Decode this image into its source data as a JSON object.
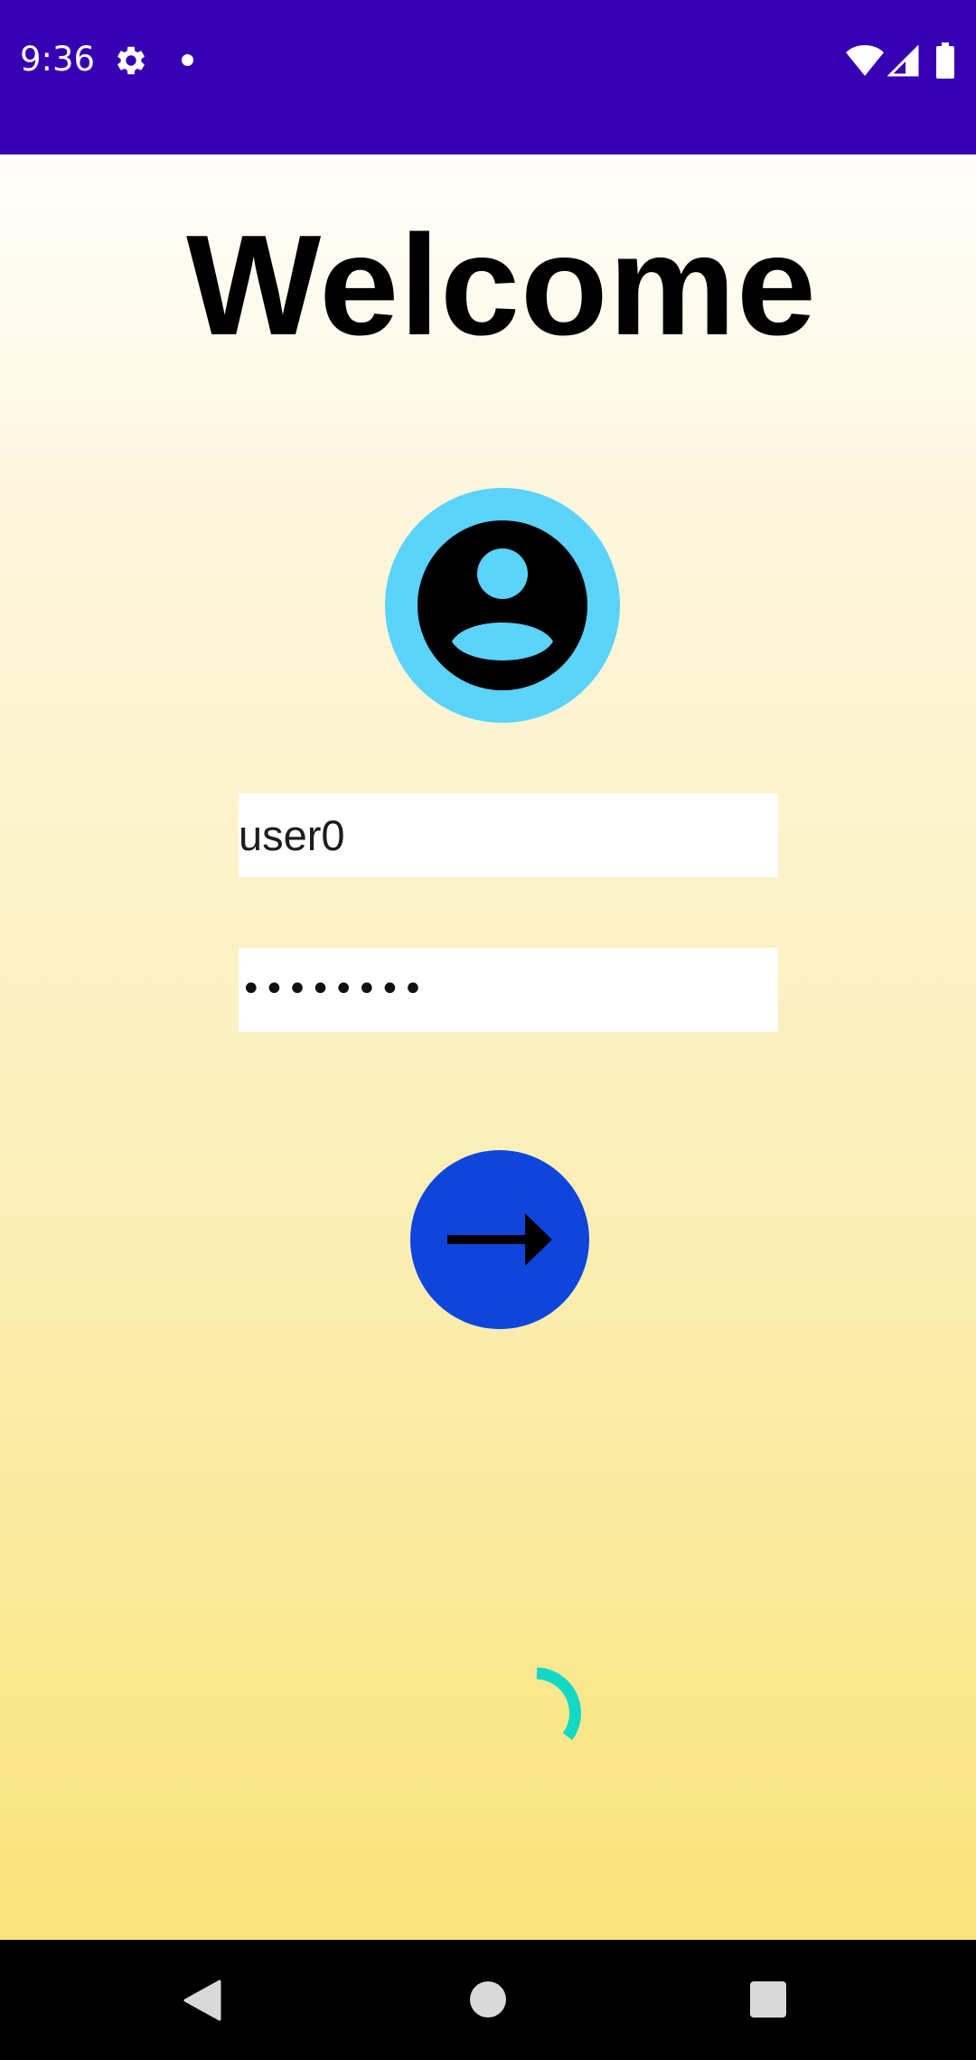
{
  "status_bar": {
    "time": "9:36",
    "background_color": "#3700b3",
    "icons": [
      "gear-icon",
      "dot-icon",
      "wifi-icon",
      "signal-icon",
      "battery-icon"
    ]
  },
  "main": {
    "title": "Welcome",
    "avatar_icon": "account-circle-icon",
    "avatar_color": "#5bd3fa",
    "username": {
      "value": "user0"
    },
    "password": {
      "masked_value": "••••••••"
    },
    "login_button": {
      "icon": "arrow-right-icon",
      "color": "#0e45dc"
    },
    "loading_indicator": {
      "icon": "progress-spinner",
      "color": "#12d9c6"
    },
    "background_gradient": [
      "#fffefb",
      "#f9e479"
    ]
  },
  "nav_bar": {
    "buttons": [
      "back",
      "home",
      "recents"
    ]
  }
}
